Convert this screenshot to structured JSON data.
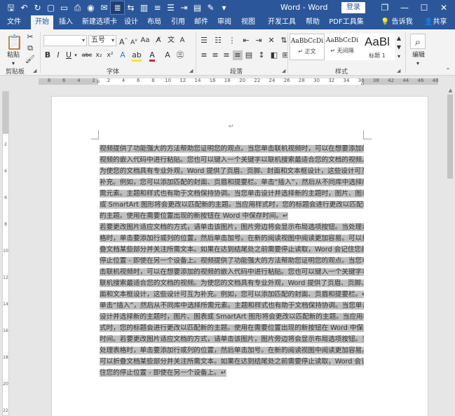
{
  "window": {
    "title": "Word - Word",
    "login_label": "登录",
    "controls": {
      "restore": "❐",
      "minimize": "—",
      "maximize": "☐",
      "close": "✕"
    }
  },
  "quick_access": {
    "icons": [
      "save-icon",
      "undo-icon",
      "redo-icon",
      "paste-icon",
      "open-icon",
      "print-icon",
      "camera-icon",
      "email-icon",
      "layout-icon",
      "align-icon",
      "customize-icon"
    ]
  },
  "tabs": [
    "文件",
    "开始",
    "插入",
    "新建选项卡",
    "设计",
    "布局",
    "引用",
    "邮件",
    "审阅",
    "视图",
    "开发工具",
    "帮助",
    "PDF工具集"
  ],
  "active_tab": "开始",
  "tellme": "告诉我",
  "share": "共享",
  "ribbon": {
    "clipboard": {
      "label": "剪贴板",
      "paste": "粘贴"
    },
    "font": {
      "label": "字体",
      "font_name": "",
      "font_size": "五号"
    },
    "paragraph": {
      "label": "段落"
    },
    "styles": {
      "label": "样式",
      "items": [
        {
          "sample": "AaBbCcDi",
          "name": "↵ 正文"
        },
        {
          "sample": "AaBbCcDi",
          "name": "↵ 无间隔"
        },
        {
          "sample": "AaBl",
          "name": "标题 1"
        }
      ]
    },
    "editing": {
      "label": "编辑"
    }
  },
  "ruler": {
    "numbers": [
      "8",
      "6",
      "4",
      "2",
      "2",
      "4",
      "6",
      "8",
      "10",
      "12",
      "14",
      "16",
      "18",
      "20",
      "22",
      "24",
      "26",
      "28",
      "30",
      "32",
      "34",
      "36",
      "38",
      "42",
      "44",
      "46",
      "48"
    ]
  },
  "document": {
    "top_mark": "↵",
    "paragraphs": [
      {
        "lines": [
          "视频提供了功能强大的方法帮助您证明您的观点。当您单击联机视频时，可以在想要添加的",
          "视频的嵌入代码中进行粘贴。您也可以键入一个关键字以联机搜索最适合您的文档的视频。",
          "为使您的文档具有专业外观，Word 提供了页眉、页脚、封面和文本框设计，这些设计可互为",
          "补充。例如，您可以添加匹配的封面、页眉和提要栏。单击“插入”，然后从不同库中选择所",
          "需元素。主题和样式也有助于文档保持协调。当您单击设计并选择新的主题时，图片、图表",
          "或 SmartArt 图形将会更改以匹配新的主题。当应用样式时，您的标题会进行更改以匹配新",
          "的主题。使用在需要位置出现的新按钮在 Word 中保存时间。↵"
        ]
      },
      {
        "lines": [
          "若要更改图片适应文档的方式，请单击该图片，图片旁边将会显示布局选项按钮。当处理表",
          "格时，单击要添加行或列的位置，然后单击加号。在新的阅读视图中阅读更加容易。可以折",
          "叠文档某些部分并关注所需文本。如果在达到结尾处之前需要停止读取，Word 会记住您的",
          "停止位置 - 即使在另一个设备上。视频提供了功能强大的方法帮助您证明您的观点。当您单",
          "击联机视频时，可以在想要添加的视频的嵌入代码中进行粘贴。您也可以键入一个关键字以",
          "联机搜索最适合您的文档的视频。为使您的文档具有专业外观，Word 提供了页眉、页脚、封",
          "面和文本框设计，这些设计可互为补充。例如，您可以添加匹配的封面、页眉和提要栏。↵"
        ]
      },
      {
        "lines": [
          "单击“插入”，然后从不同库中选择所需元素。主题和样式也有助于文档保持协调。当您单击",
          "设计并选择新的主题时，图片、图表或 SmartArt 图形将会更改以匹配新的主题。当应用样",
          "式时，您的标题会进行更改以匹配新的主题。使用在需要位置出现的新按钮在 Word 中保存",
          "时间。若要更改图片适应文档的方式，请单击该图片，图片旁边将会显示布局选项按钮。当",
          "处理表格时，单击要添加行或列的位置，然后单击加号。在新的阅读视图中阅读更加容易。",
          "可以折叠文档某些部分并关注所需文本。如果在达到结尾处之前需要停止读取，Word 会记",
          "住您的停止位置 - 即使在另一个设备上。↵"
        ]
      }
    ]
  }
}
